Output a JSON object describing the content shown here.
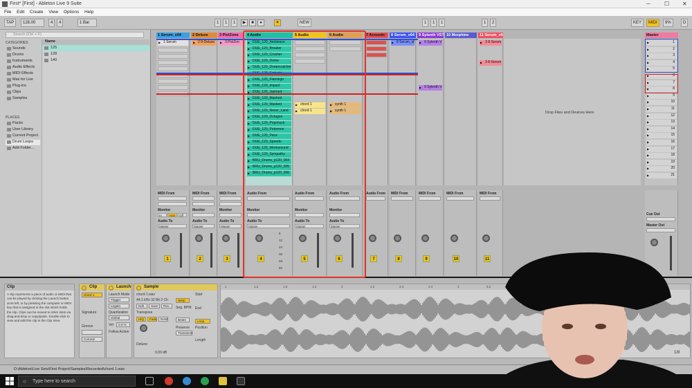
{
  "window": {
    "title": "First*  [First] - Ableton Live 9 Suite"
  },
  "menu": [
    "File",
    "Edit",
    "Create",
    "View",
    "Options",
    "Help"
  ],
  "transport": {
    "tap": "TAP",
    "tempo": "128.00",
    "sig_num": "4",
    "sig_den": "4",
    "quant": "1 Bar",
    "pos1": "1",
    "pos2": "1",
    "pos3": "1",
    "pos4": "1",
    "loop1": "1",
    "loop2": "1",
    "loop3": "1",
    "end1": "1",
    "end2": "2",
    "nudge": "NEW",
    "key": "KEY",
    "midi": "MIDI",
    "cpu": "9%",
    "d": "D"
  },
  "browser": {
    "search_placeholder": "Search (Ctrl + F)",
    "categories_label": "CATEGORIES",
    "categories": [
      "Sounds",
      "Drums",
      "Instruments",
      "Audio Effects",
      "MIDI Effects",
      "Max for Live",
      "Plug-ins",
      "Clips",
      "Samples"
    ],
    "places_label": "PLACES",
    "places": [
      "Packs",
      "User Library",
      "Current Project",
      "Drum Loops",
      "Add Folder..."
    ],
    "files_header": "Name",
    "files": [
      "125",
      "128",
      "140"
    ]
  },
  "tracks": [
    {
      "name": "1 Serum_x64",
      "color": "#3ba0e0"
    },
    {
      "name": "2 Deluxe",
      "color": "#e08a3a"
    },
    {
      "name": "3 PiviZone",
      "color": "#f06ab0"
    },
    {
      "name": "4 Audio",
      "color": "#20c0a0"
    },
    {
      "name": "5 Audio",
      "color": "#f4c21a"
    },
    {
      "name": "6 Audio",
      "color": "#e0a050"
    },
    {
      "name": "7 Acoustic",
      "color": "#e05050"
    },
    {
      "name": "8 Serum_x64",
      "color": "#3a50f0"
    },
    {
      "name": "9 Sylenth VST",
      "color": "#8a3ad0"
    },
    {
      "name": "10 Morphine",
      "color": "#5a5ad0"
    },
    {
      "name": "11 Serum_x64",
      "color": "#f05060"
    }
  ],
  "master": {
    "name": "Master",
    "color": "#f07aa0",
    "scenes": [
      "1",
      "2",
      "3",
      "4",
      "5",
      "6",
      "7",
      "8",
      "9",
      "10",
      "11",
      "12",
      "13",
      "14",
      "15",
      "16",
      "17",
      "18",
      "19",
      "20",
      "21"
    ]
  },
  "clips": {
    "serum1": "1 Serum",
    "deluxe1": "2 8-Deluxe",
    "pivi1": "3 PiviZon",
    "audio4": [
      "DUE_120_Ambience",
      "DUE_120_Breaker",
      "DUE_120_Crusher",
      "DUE_120_Dome",
      "DUE_120_Dreamcatcher",
      "DUE_120_Fortyate",
      "DUE_120_Flamingo",
      "DUE_120_Impact",
      "DUE_120_Jamned",
      "DUE_120_Mashed",
      "DUE_120_Masked",
      "DUE_120_Never_Land",
      "DUE_120_Octagon",
      "DUE_120_Popchuck",
      "DUE_120_Pokemon",
      "DUE_120_Pace",
      "DUE_120_Speedo",
      "DUE_120_Workaround",
      "DUE_120_Sympathy",
      "BRU_Drums_p120_004",
      "BRU_Drums_p120_005",
      "BRU_Drums_p120_006"
    ],
    "audio5": [
      "chord 1",
      "chord 1"
    ],
    "audio6": [
      "synth 1",
      "synth 1"
    ],
    "serum8": "8 Serum_x64",
    "sylenth9": "9 Sylenth VST",
    "serum11a": "3 8-Serum",
    "serum11b": "3 8-Serum"
  },
  "dropzone": "Drop Files and Devices Here",
  "mixer": {
    "midi_from": "MIDI From",
    "audio_from": "Audio From",
    "monitor": "Monitor",
    "audio_to": "Audio To",
    "master_label": "Master",
    "in": "In",
    "auto": "Auto",
    "off": "Off",
    "cue_out": "Cue Out",
    "master_out": "Master Out",
    "vol": "-inf",
    "track_numbers": [
      "1",
      "2",
      "3",
      "4",
      "5",
      "6",
      "7",
      "8",
      "9",
      "10",
      "11"
    ],
    "db_marks": [
      "6",
      "12",
      "24",
      "36",
      "48",
      "60"
    ]
  },
  "info": {
    "title": "Clip",
    "body": "A clip represents a piece of audio or MIDI that can be played by clicking the Launch button at its left, or by pressing the computer or MIDI key that is assigned to the slot which holds the clip. Clips can be moved to other slots via drag-and-drop or copy/paste. Double-click to view and edit this clip in the Clip View."
  },
  "clipview": {
    "clip_title": "Clip",
    "clip_name": "chord 1",
    "launch_title": "Launch",
    "sample_title": "Sample",
    "signature": "Signature",
    "groove": "Groove",
    "commit": "Commit",
    "launch_mode": "Launch Mode",
    "trigger": "Trigger",
    "legato": "Legato",
    "quantization": "Quantization",
    "global": "Global",
    "vel": "Vel",
    "vel_val": "0.0 %",
    "follow_action": "Follow Action",
    "sample_name": "chord 1.wav",
    "sample_info": "44.1 kHz 32 Bit 2 Ch",
    "warp": "Warp",
    "start": "Start",
    "end": "End",
    "loop": "Loop",
    "position": "Position",
    "length": "Length",
    "transpose": "Transpose",
    "detune": "Detune",
    "seg_bpm": "Seg. BPM",
    "beats": "Beats",
    "preserve": "Preserve",
    "transients": "Transients",
    "gain": "0.00 dB",
    "hiq": "HiQ",
    "fade": "Fade",
    "ram": "RAM",
    "edit": "Edit",
    "save": "Save",
    "rev": "Rev.",
    "ruler": [
      "1",
      "1.2",
      "1.3",
      "1.4",
      "2",
      "2.2",
      "2.3",
      "2.4",
      "3",
      "3.2",
      "3.3",
      "3.4",
      "4",
      "4.2",
      "4.3",
      "4.4"
    ],
    "page": "1/8"
  },
  "statusbar": {
    "path": "D:\\Ableton\\Live Sets\\First Project\\Samples\\Recorded\\chord 1.wav"
  },
  "taskbar": {
    "search_placeholder": "Type here to search"
  }
}
